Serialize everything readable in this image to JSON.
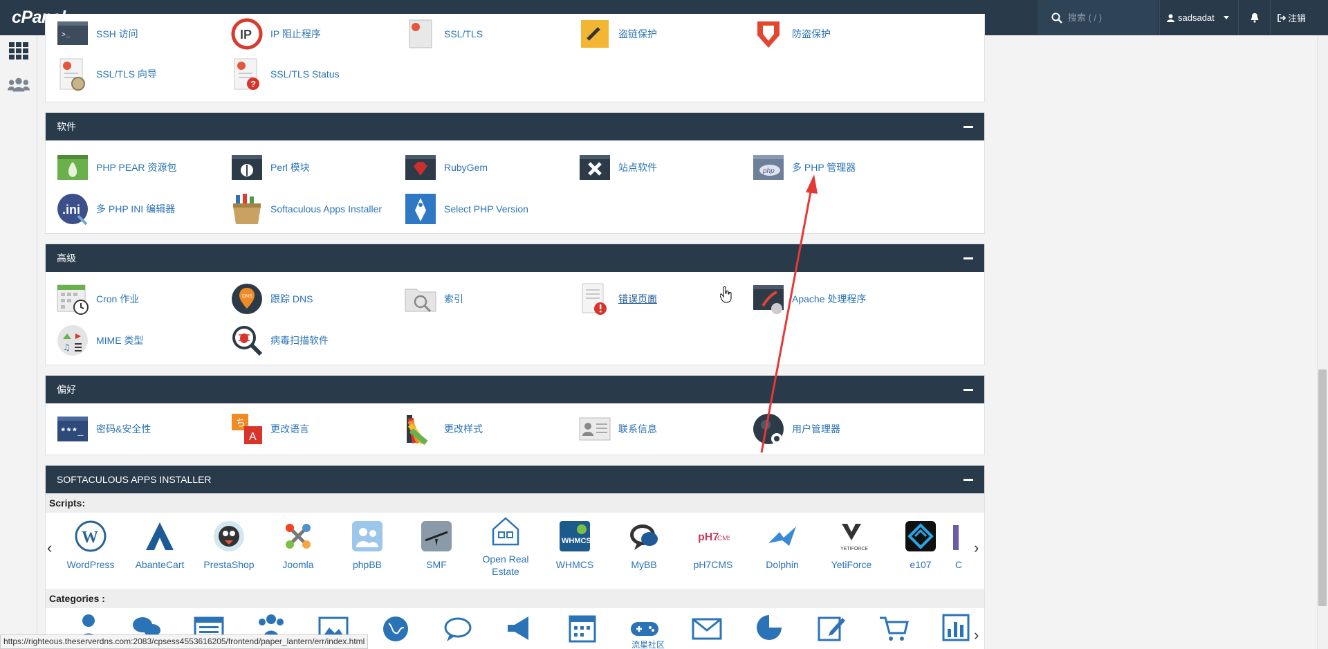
{
  "topbar": {
    "logo": "cPanel",
    "search_placeholder": "搜索 ( / )",
    "username": "sadsadat",
    "logout_label": "注销"
  },
  "sections": {
    "security_partial": {
      "row_top": [
        "SSH 访问",
        "IP 阻止程序",
        "SSL/TLS",
        "盗链保护",
        "防盗保护"
      ],
      "row2": [
        "SSL/TLS 向导",
        "SSL/TLS Status"
      ]
    },
    "software": {
      "title": "软件",
      "items": [
        "PHP PEAR 资源包",
        "Perl 模块",
        "RubyGem",
        "站点软件",
        "多 PHP 管理器",
        "多 PHP INI 编辑器",
        "Softaculous Apps Installer",
        "Select PHP Version"
      ]
    },
    "advanced": {
      "title": "高级",
      "items": [
        "Cron 作业",
        "跟踪 DNS",
        "索引",
        "错误页面",
        "Apache 处理程序",
        "MIME 类型",
        "病毒扫描软件"
      ]
    },
    "preferences": {
      "title": "偏好",
      "items": [
        "密码&安全性",
        "更改语言",
        "更改样式",
        "联系信息",
        "用户管理器"
      ]
    },
    "softaculous": {
      "title": "SOFTACULOUS APPS INSTALLER",
      "scripts_label": "Scripts:",
      "categories_label": "Categories :",
      "scripts": [
        "WordPress",
        "AbanteCart",
        "PrestaShop",
        "Joomla",
        "phpBB",
        "SMF",
        "Open Real Estate",
        "WHMCS",
        "MyBB",
        "pH7CMS",
        "Dolphin",
        "YetiForce",
        "e107",
        "C"
      ],
      "category_partial_label": "流星社区"
    }
  },
  "status_url": "https://righteous.theserverdns.com:2083/cpsess4553616205/frontend/paper_lantern/err/index.html",
  "colors": {
    "header": "#293a4a",
    "link": "#2a73b6",
    "annotation_arrow": "#e53935"
  }
}
